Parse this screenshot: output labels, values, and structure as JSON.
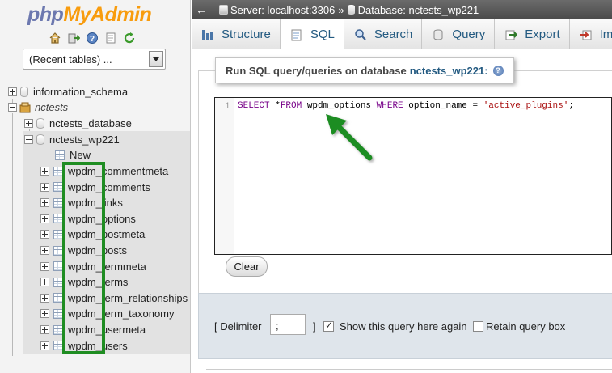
{
  "logo": {
    "part1": "php",
    "part2": "MyAdmin"
  },
  "nav_icons": [
    "home-icon",
    "logout-icon",
    "help-icon",
    "docs-icon",
    "reload-icon"
  ],
  "recent_tables": {
    "selected": "(Recent tables) ..."
  },
  "tree": {
    "information_schema": "information_schema",
    "nctests": "nctests",
    "nctests_database": "nctests_database",
    "nctests_wp221": "nctests_wp221",
    "new_label": "New",
    "tables": [
      "wpdm_commentmeta",
      "wpdm_comments",
      "wpdm_links",
      "wpdm_options",
      "wpdm_postmeta",
      "wpdm_posts",
      "wpdm_termmeta",
      "wpdm_terms",
      "wpdm_term_relationships",
      "wpdm_term_taxonomy",
      "wpdm_usermeta",
      "wpdm_users"
    ]
  },
  "breadcrumb": {
    "server": "Server: localhost:3306",
    "separator": "»",
    "database": "Database: nctests_wp221"
  },
  "tabs": [
    {
      "label": "Structure",
      "icon": "structure-icon"
    },
    {
      "label": "SQL",
      "icon": "sql-icon"
    },
    {
      "label": "Search",
      "icon": "search-icon"
    },
    {
      "label": "Query",
      "icon": "query-icon"
    },
    {
      "label": "Export",
      "icon": "export-icon"
    },
    {
      "label": "Impo",
      "icon": "import-icon"
    }
  ],
  "sql_panel": {
    "legend_prefix": "Run SQL query/queries on database",
    "legend_db": "nctests_wp221:",
    "line_number": "1",
    "query": {
      "kw1": "SELECT",
      "p1": " *",
      "kw2": "FROM",
      "p2": " wpdm_options ",
      "kw3": "WHERE",
      "p3": " option_name = ",
      "str": "'active_plugins'",
      "p4": ";"
    },
    "clear_label": "Clear"
  },
  "options": {
    "delimiter_label": "[ Delimiter",
    "delimiter_value": ";",
    "delimiter_close": "]",
    "show_query_label": "Show this query here again",
    "show_query_checked": true,
    "retain_label": "Retain query box",
    "retain_checked": false
  },
  "colors": {
    "annotation": "#1f8d22",
    "link": "#235a81"
  }
}
